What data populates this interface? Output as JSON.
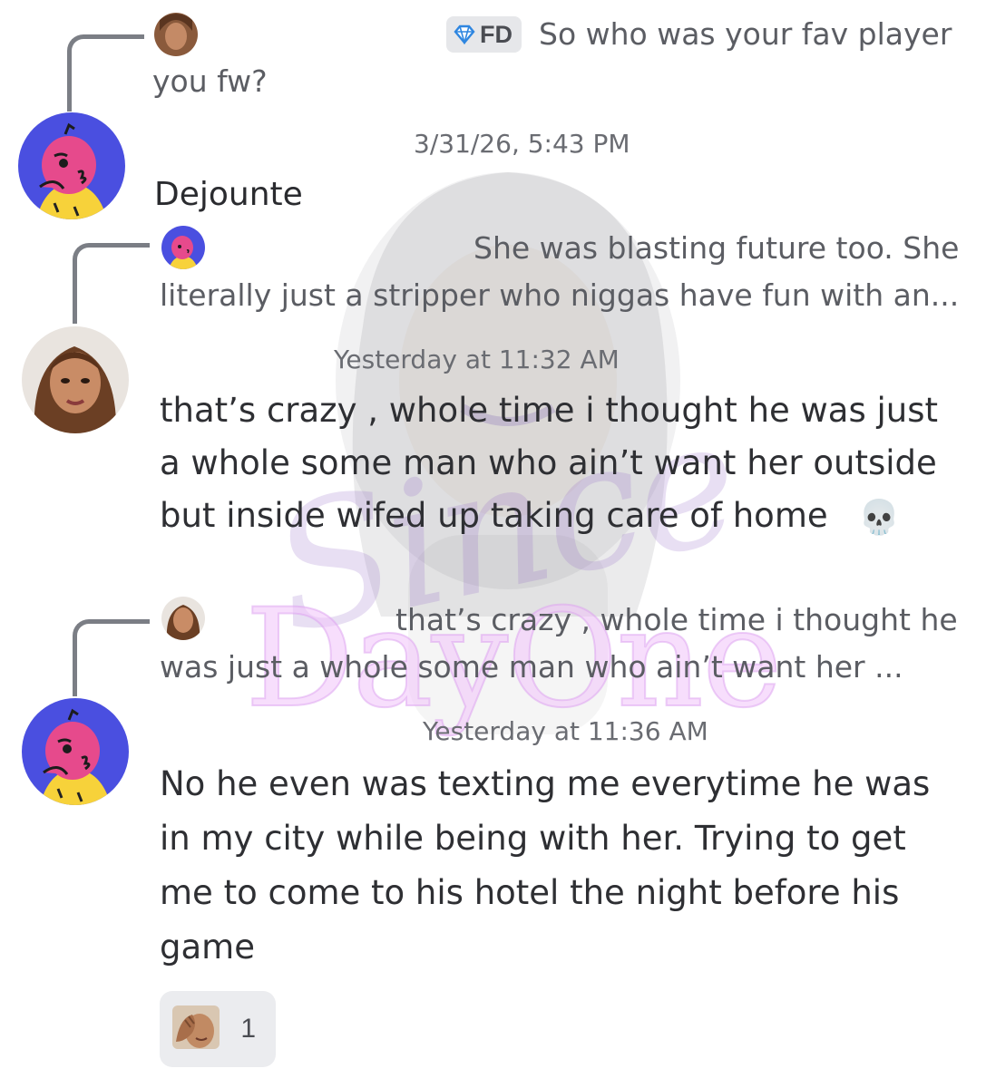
{
  "messages": [
    {
      "reply_preview": {
        "badge": "FD",
        "badge_icon": "diamond-icon",
        "line1": "So who was your fav player",
        "line2": "you fw?"
      },
      "timestamp": "3/31/26, 5:43 PM",
      "username": "Dejounte",
      "lines": [
        "Dejounte"
      ]
    },
    {
      "reply_preview": {
        "line1": "She was blasting future too. She",
        "line2": "literally just a stripper who niggas have fun with an..."
      },
      "timestamp": "Yesterday at 11:32 AM",
      "lines": [
        "that’s crazy , whole time i thought he was just",
        "a whole some man who ain’t want her outside",
        "but inside wifed up taking care of home"
      ],
      "emoji": "💀"
    },
    {
      "reply_preview": {
        "line1": "that’s crazy , whole time i thought he",
        "line2": "was just a whole some man who ain’t want her ..."
      },
      "timestamp": "Yesterday at 11:36 AM",
      "lines": [
        "No he even was texting me everytime he was",
        "in my city while being with her. Trying to get",
        "me to come to his hotel the night before his",
        "game"
      ],
      "reaction": {
        "icon": "facepalm-man-icon",
        "count": "1"
      }
    }
  ],
  "watermark": {
    "word1": "Since",
    "word2": "DayOne"
  }
}
